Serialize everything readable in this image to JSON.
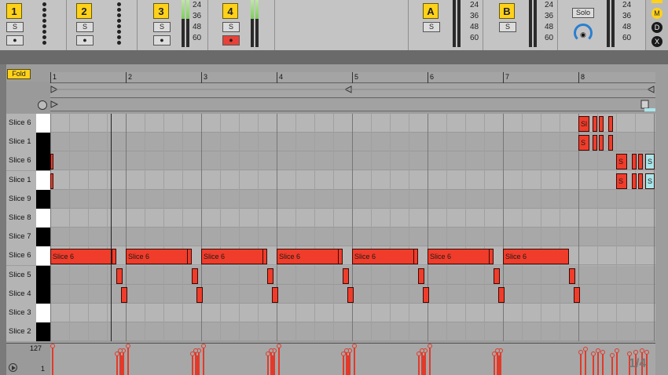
{
  "mixer": {
    "tracks": [
      {
        "num": "1",
        "solo": "S",
        "arm": "●"
      },
      {
        "num": "2",
        "solo": "S",
        "arm": "●"
      },
      {
        "num": "3",
        "solo": "S",
        "arm": "●"
      },
      {
        "num": "4",
        "solo": "S",
        "arm": "●"
      }
    ],
    "returns": [
      {
        "num": "A",
        "solo": "S"
      },
      {
        "num": "B",
        "solo": "S"
      }
    ],
    "master": {
      "solo_label": "Solo"
    },
    "scale": [
      "24",
      "36",
      "48",
      "60"
    ],
    "side_buttons": [
      "M",
      "D",
      "X"
    ]
  },
  "editor": {
    "fold_label": "Fold",
    "ruler": [
      "1",
      "2",
      "3",
      "4",
      "5",
      "6",
      "7",
      "8"
    ],
    "keys": [
      "Slice 6",
      "Slice 1",
      "Slice 6",
      "Slice 1",
      "Slice 9",
      "Slice 8",
      "Slice 7",
      "Slice 6",
      "Slice 5",
      "Slice 4",
      "Slice 3",
      "Slice 2"
    ],
    "note_label": "Slice 6",
    "note_short": "Sl",
    "note_s": "S",
    "velocity": {
      "max": "127",
      "min": "1"
    },
    "page_indicator": "1/4"
  },
  "colors": {
    "note": "#f03c2a",
    "note_alt": "#a9e6ea",
    "accent": "#ffd21a",
    "meter": "#7ccf5a"
  }
}
